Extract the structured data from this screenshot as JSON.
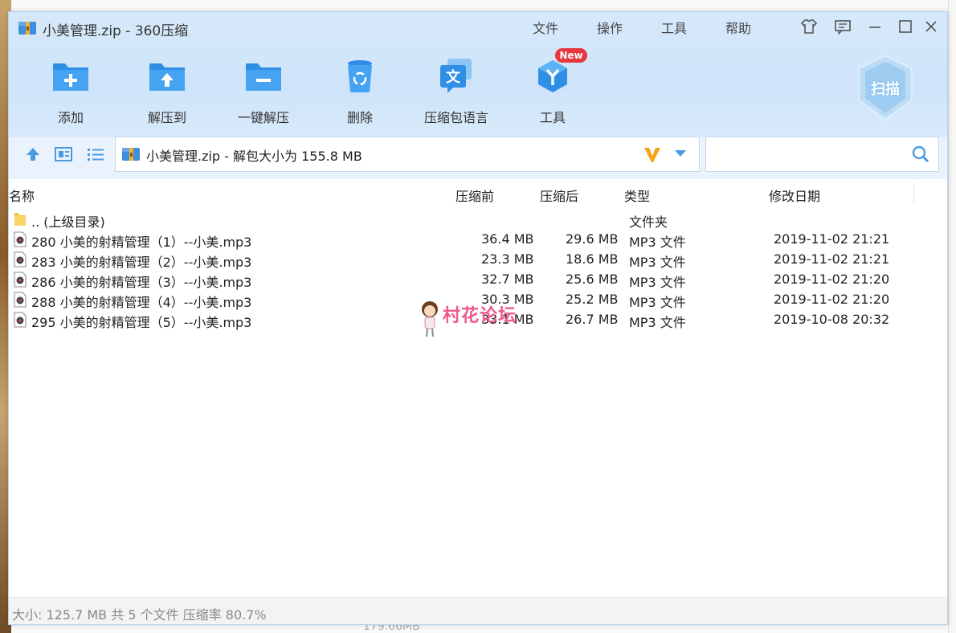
{
  "window": {
    "title": "小美管理.zip - 360压缩",
    "menu": [
      "文件",
      "操作",
      "工具",
      "帮助"
    ]
  },
  "toolbar": {
    "buttons": [
      {
        "label": "添加",
        "icon": "add-folder-icon"
      },
      {
        "label": "解压到",
        "icon": "extract-to-icon"
      },
      {
        "label": "一键解压",
        "icon": "one-click-extract-icon"
      },
      {
        "label": "删除",
        "icon": "delete-icon"
      },
      {
        "label": "压缩包语言",
        "icon": "archive-language-icon"
      },
      {
        "label": "工具",
        "icon": "tools-icon"
      }
    ],
    "new_badge": "New",
    "scan_label": "扫描"
  },
  "address": {
    "path": "小美管理.zip - 解包大小为 155.8 MB",
    "search_placeholder": ""
  },
  "columns": [
    "名称",
    "压缩前",
    "压缩后",
    "类型",
    "修改日期"
  ],
  "parent_row": {
    "name": ".. (上级目录)",
    "type": "文件夹"
  },
  "files": [
    {
      "name": "280 小美的射精管理（1）--小美.mp3",
      "before": "36.4 MB",
      "after": "29.6 MB",
      "type": "MP3 文件",
      "date": "2019-11-02 21:21"
    },
    {
      "name": "283 小美的射精管理（2）--小美.mp3",
      "before": "23.3 MB",
      "after": "18.6 MB",
      "type": "MP3 文件",
      "date": "2019-11-02 21:21"
    },
    {
      "name": "286 小美的射精管理（3）--小美.mp3",
      "before": "32.7 MB",
      "after": "25.6 MB",
      "type": "MP3 文件",
      "date": "2019-11-02 21:20"
    },
    {
      "name": "288 小美的射精管理（4）--小美.mp3",
      "before": "30.3 MB",
      "after": "25.2 MB",
      "type": "MP3 文件",
      "date": "2019-11-02 21:20"
    },
    {
      "name": "295 小美的射精管理（5）--小美.mp3",
      "before": "33.1 MB",
      "after": "26.7 MB",
      "type": "MP3 文件",
      "date": "2019-10-08 20:32"
    }
  ],
  "status": "大小: 125.7 MB 共 5 个文件 压缩率 80.7%",
  "watermark": "村花论坛",
  "background_text": "179.66MB",
  "colors": {
    "accent": "#2f8fe6",
    "header_bg": "#d6e9fb",
    "badge": "#e8383d",
    "watermark": "#f05a8c"
  }
}
